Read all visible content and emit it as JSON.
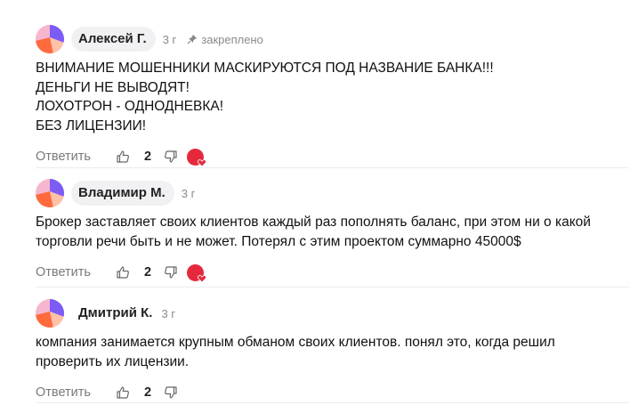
{
  "comments": [
    {
      "author": "Алексей Г.",
      "time": "3 г",
      "pinned_label": "закреплено",
      "lines": [
        "ВНИМАНИЕ МОШЕННИКИ МАСКИРУЮТСЯ ПОД НАЗВАНИЕ БАНКА!!!",
        "ДЕНЬГИ НЕ ВЫВОДЯТ!",
        "ЛОХОТРОН - ОДНОДНЕВКА!",
        "БЕЗ ЛИЦЕНЗИИ!"
      ],
      "reply_label": "Ответить",
      "likes": "2",
      "has_badge": true
    },
    {
      "author": "Владимир М.",
      "time": "3 г",
      "lines": [
        "Брокер заставляет своих клиентов каждый раз пополнять баланс, при этом ни о какой",
        "торговли речи быть и не может. Потерял с этим проектом суммарно 45000$"
      ],
      "reply_label": "Ответить",
      "likes": "2",
      "has_badge": true
    },
    {
      "author": "Дмитрий К.",
      "time": "3 г",
      "lines": [
        "компания занимается крупным обманом своих клиентов. понял это, когда решил",
        "проверить их лицензии."
      ],
      "reply_label": "Ответить",
      "likes": "2",
      "has_badge": false
    }
  ],
  "colors": {
    "badge": "#e5293d",
    "avatar_purple": "#7b5cf5",
    "avatar_orange": "#ff6a3d",
    "avatar_pink": "#f7b6cf"
  }
}
